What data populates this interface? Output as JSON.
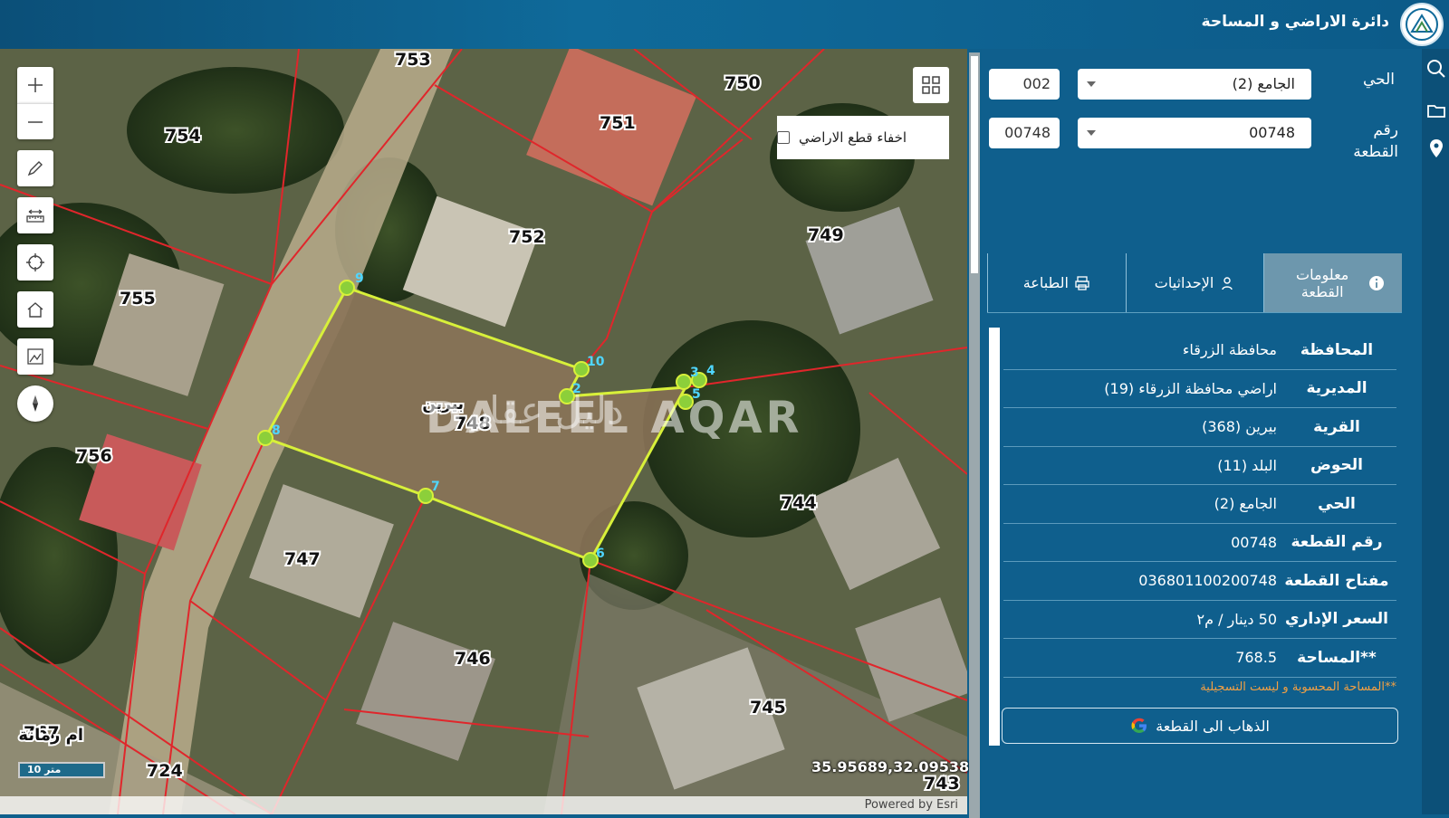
{
  "header": {
    "title": "دائرة الاراضي و المساحة"
  },
  "map": {
    "hide_parcels_label": "اخفاء قطع الاراضي",
    "scale_label": "10 متر",
    "coordinates": "35.95689,32.09538",
    "attribution": "Powered by Esri",
    "watermark_en": "DALEEL AQAR",
    "watermark_ar": "دليل عقار",
    "place_label_1": "بيرين",
    "place_label_2": "ام رمانة",
    "parcel_numbers": [
      "753",
      "750",
      "751",
      "754",
      "752",
      "749",
      "755",
      "748",
      "756",
      "744",
      "747",
      "746",
      "745",
      "767",
      "724",
      "743"
    ],
    "vertex_numbers": [
      "9",
      "10",
      "2",
      "3",
      "4",
      "5",
      "8",
      "7",
      "6"
    ]
  },
  "search": {
    "district_label": "الحي",
    "district_code": "002",
    "district_select": "الجامع (2)",
    "parcel_label": "رقم القطعة",
    "parcel_code": "00748",
    "parcel_select": "00748"
  },
  "tabs": [
    {
      "label": "معلومات القطعة",
      "icon": "info-icon",
      "active": true
    },
    {
      "label": "الإحداثيات",
      "icon": "location-person-icon",
      "active": false
    },
    {
      "label": "الطباعة",
      "icon": "printer-icon",
      "active": false
    }
  ],
  "info": [
    {
      "key": "المحافظة",
      "value": "محافظة الزرقاء"
    },
    {
      "key": "المديرية",
      "value": "اراضي محافظة الزرقاء (19)"
    },
    {
      "key": "القرية",
      "value": "بيرين (368)"
    },
    {
      "key": "الحوض",
      "value": "البلد (11)"
    },
    {
      "key": "الحي",
      "value": "الجامع (2)"
    },
    {
      "key": "رقم القطعة",
      "value": "00748"
    },
    {
      "key": "مفتاح القطعة",
      "value": "036801100200748"
    },
    {
      "key": "السعر الإداري",
      "value": "50 دينار / م٢"
    },
    {
      "key": "**المساحة",
      "value": "768.5"
    }
  ],
  "note": "**المساحة المحسوبة و ليست التسجيلية",
  "goto_button": "الذهاب الى القطعة",
  "colors": {
    "header": "#0f6a9a",
    "panel": "#0f5f8d",
    "parcel_outline": "#e0262b",
    "selected_outline": "#d8f03a",
    "note": "#f2a044"
  }
}
